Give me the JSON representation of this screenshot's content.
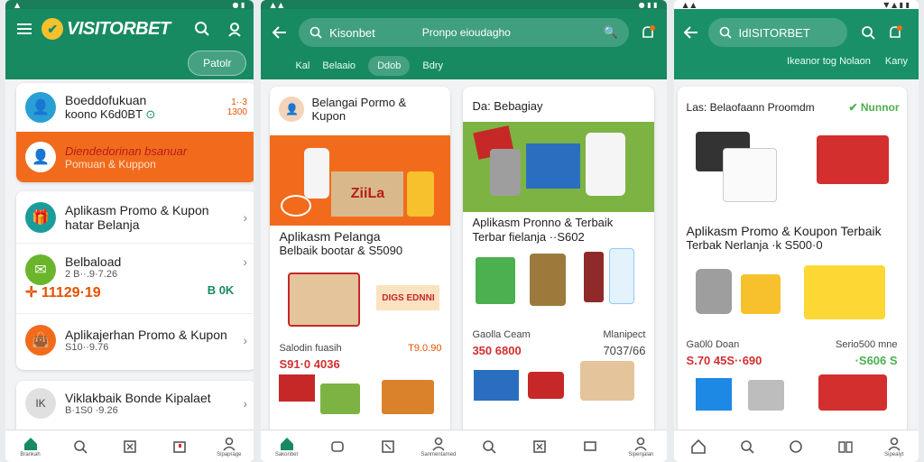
{
  "colors": {
    "brand_green": "#178a62",
    "accent_orange": "#f26b1d",
    "price_red": "#d32f2f",
    "logo_yellow": "#f6c12c"
  },
  "screen1": {
    "logo_text": "VISITORBET",
    "pill": "Patolr",
    "profile": {
      "name": "Boeddofukuan",
      "sub": "koono K6d0BT",
      "badge_top": "1··3",
      "badge_bottom": "1300"
    },
    "highlight": {
      "title": "Diendedorinan bsanuar",
      "sub": "Pomuan & Kuppon"
    },
    "items": [
      {
        "title": "Aplikasm Promo & Kupon",
        "sub": "hatar Belanja",
        "icon": "gift-icon"
      },
      {
        "title": "Belbaload",
        "sub": "2 B··.9·7.26",
        "price": "✛ 11129·19",
        "right": "B 0K"
      },
      {
        "title": "Aplikajerhan Promo & Kupon",
        "sub": "S10··9.76",
        "icon": "bag-icon"
      }
    ],
    "footer_item": {
      "title": "Viklakbaik Bonde Kipalaet",
      "sub": "B·1S0 ·9.26"
    },
    "nav": [
      "Brankah",
      "",
      "",
      "",
      "Sipaprage"
    ]
  },
  "screen2": {
    "search_text": "Kisonbet",
    "search_title": "Pronpo eioudagho",
    "tabs": [
      "Kal",
      "Belaaio",
      "Ddob",
      "Bdry"
    ],
    "card1": {
      "header": "Belangai Pormo & Kupon",
      "title": "Aplikasm Pelanga",
      "subtitle": "Belbaik bootar & S5090",
      "tag": "DIGS EDNNI",
      "label_left": "Salodin fuasih",
      "label_right": "T9.0.90",
      "price": "S91·0 4036",
      "box_text": "ZiiLa"
    },
    "card2": {
      "header": "Da: Bebagiay",
      "title": "Aplikasm Pronno & Terbaik",
      "subtitle": "Terbar fielanja ··S602",
      "label_left": "Gaolla Ceam",
      "label_right": "Mlanipect",
      "price": "350 6800",
      "price_right": "7037/66"
    },
    "nav": [
      "Sakonbet",
      "",
      "",
      "Sanmentamed",
      "",
      "",
      "",
      "Sipenjalan"
    ]
  },
  "screen3": {
    "search_text": "IdISITORBET",
    "tabs_right": "Ikeanor tog Nolaon",
    "tab_end": "Kany",
    "card_header": "Las: Belaofaann Proomdm",
    "card_tag": "✔ Nunnor",
    "title": "Aplikasm Promo & Koupon Terbaik",
    "subtitle": "Terbak Nerlanja ·k S500·0",
    "label_left": "Ga0l0 Doan",
    "label_right": "Serio500 mne",
    "price": "S.70 45S··690",
    "price_right": "·S606 S",
    "nav": [
      "",
      "",
      "",
      "",
      "Sipealyt"
    ]
  }
}
